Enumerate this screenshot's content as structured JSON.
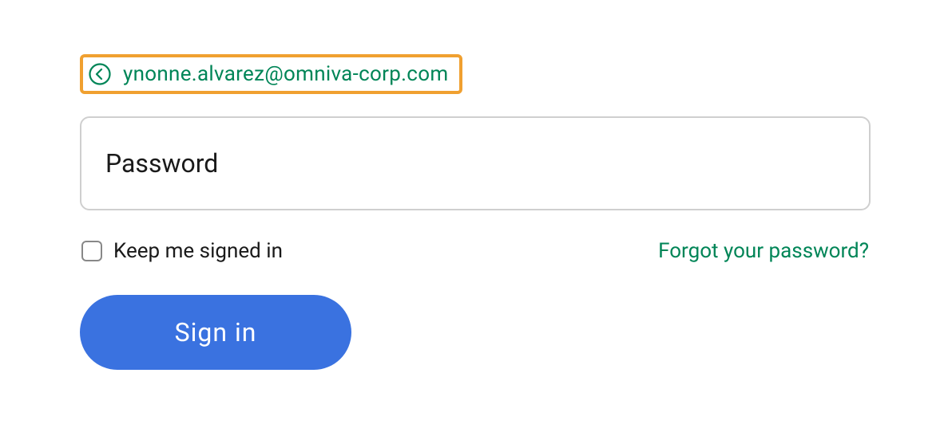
{
  "header": {
    "email": "ynonne.alvarez@omniva-corp.com"
  },
  "form": {
    "password_placeholder": "Password",
    "keep_signed_in_label": "Keep me signed in",
    "forgot_password_label": "Forgot your password?",
    "signin_label": "Sign in"
  },
  "colors": {
    "accent_green": "#008557",
    "highlight_border": "#f0a030",
    "button_blue": "#3a72e0"
  }
}
